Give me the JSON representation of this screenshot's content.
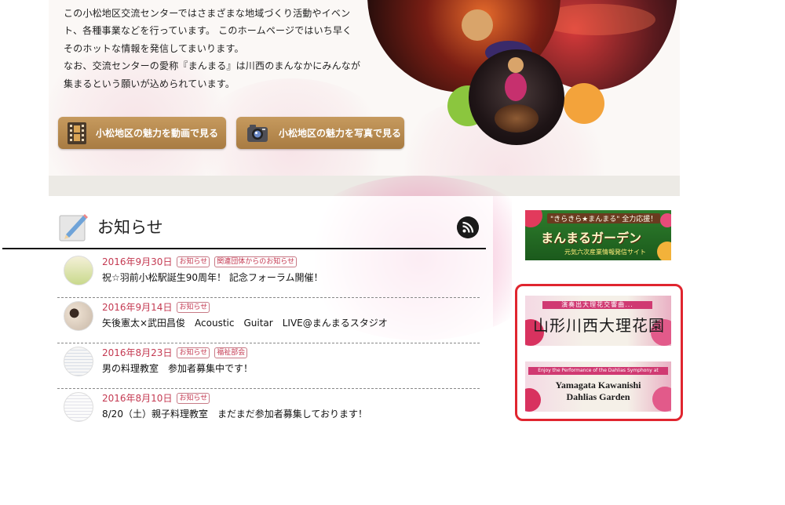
{
  "intro": {
    "lines": [
      "この小松地区交流センターではさまざまな地域づくり活動やイベン",
      "ト、各種事業などを行っています。 このホームページではいち早く",
      "そのホットな情報を発信してまいります。",
      "なお、交流センターの愛称『まんまる』は川西のまんなかにみんなが",
      "集まるという願いが込められています。"
    ]
  },
  "buttons": {
    "video_label": "小松地区の魅力を動画で見る",
    "photo_label": "小松地区の魅力を写真で見る"
  },
  "news": {
    "title": "お知らせ",
    "items": [
      {
        "date": "2016年9月30日",
        "tags": [
          "お知らせ",
          "関連団体からのお知らせ"
        ],
        "text": "祝☆羽前小松駅誕生90周年！ 記念フォーラム開催！"
      },
      {
        "date": "2016年9月14日",
        "tags": [
          "お知らせ"
        ],
        "text": "矢後憲太×武田昌俊　Acoustic　Guitar　LIVE@まんまるスタジオ"
      },
      {
        "date": "2016年8月23日",
        "tags": [
          "お知らせ",
          "福祉部会"
        ],
        "text": "男の料理教室　参加者募集中です！"
      },
      {
        "date": "2016年8月10日",
        "tags": [
          "お知らせ"
        ],
        "text": "8/20（土）親子料理教室　まだまだ参加者募集しております！"
      }
    ]
  },
  "sidebar": {
    "garden": {
      "top": "\"きらきら★まんまる\" 全力応援！",
      "main": "まんまるガーデン",
      "sub": "元気六次産業情報発信サイト"
    },
    "dahlia_jp": {
      "strip": "演奏出大理花交響曲...",
      "title": "山形川西大理花園"
    },
    "dahlia_en": {
      "strip": "Enjoy the Performance of the Dahlias Symphony at",
      "line1": "Yamagata Kawanishi",
      "line2": "Dahlias Garden"
    }
  },
  "colors": {
    "accent_red": "#e0252f",
    "date_pink": "#c43a52",
    "button_brown": "#b88b50"
  }
}
